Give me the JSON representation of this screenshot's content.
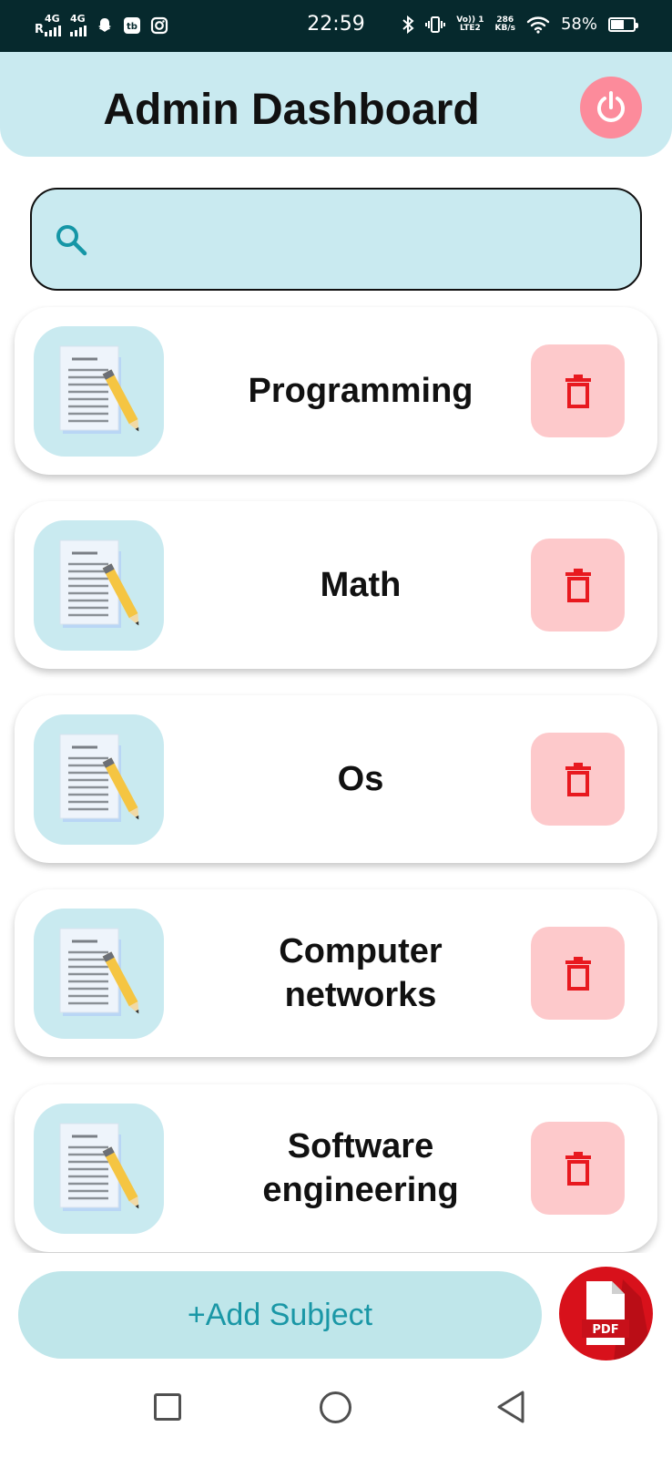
{
  "status_bar": {
    "roaming": "R",
    "sim1_network": "4G",
    "sim2_network": "4G",
    "time": "22:59",
    "volte": "Vo)) 1",
    "lte": "LTE2",
    "speed_value": "286",
    "speed_unit": "KB/s",
    "battery_percent": "58%",
    "battery_level": 0.58
  },
  "header": {
    "title": "Admin Dashboard"
  },
  "search": {
    "value": "",
    "placeholder": ""
  },
  "subjects": [
    {
      "name": "Programming"
    },
    {
      "name": "Math"
    },
    {
      "name": "Os"
    },
    {
      "name": "Computer\nnetworks"
    },
    {
      "name": "Software\nengineering"
    }
  ],
  "actions": {
    "add_subject_label": "+Add Subject",
    "pdf_label": "PDF"
  },
  "icons": {
    "power": "power-icon",
    "search": "search-icon",
    "document": "document-pencil-icon",
    "delete": "trash-icon",
    "pdf": "pdf-file-icon"
  },
  "colors": {
    "header_bg": "#c9eaf0",
    "power_bg": "#fc8b9b",
    "delete_bg": "#fdc9cb",
    "delete_icon": "#e8191f",
    "accent_text": "#1a97a6",
    "pdf_red": "#d8111b"
  }
}
